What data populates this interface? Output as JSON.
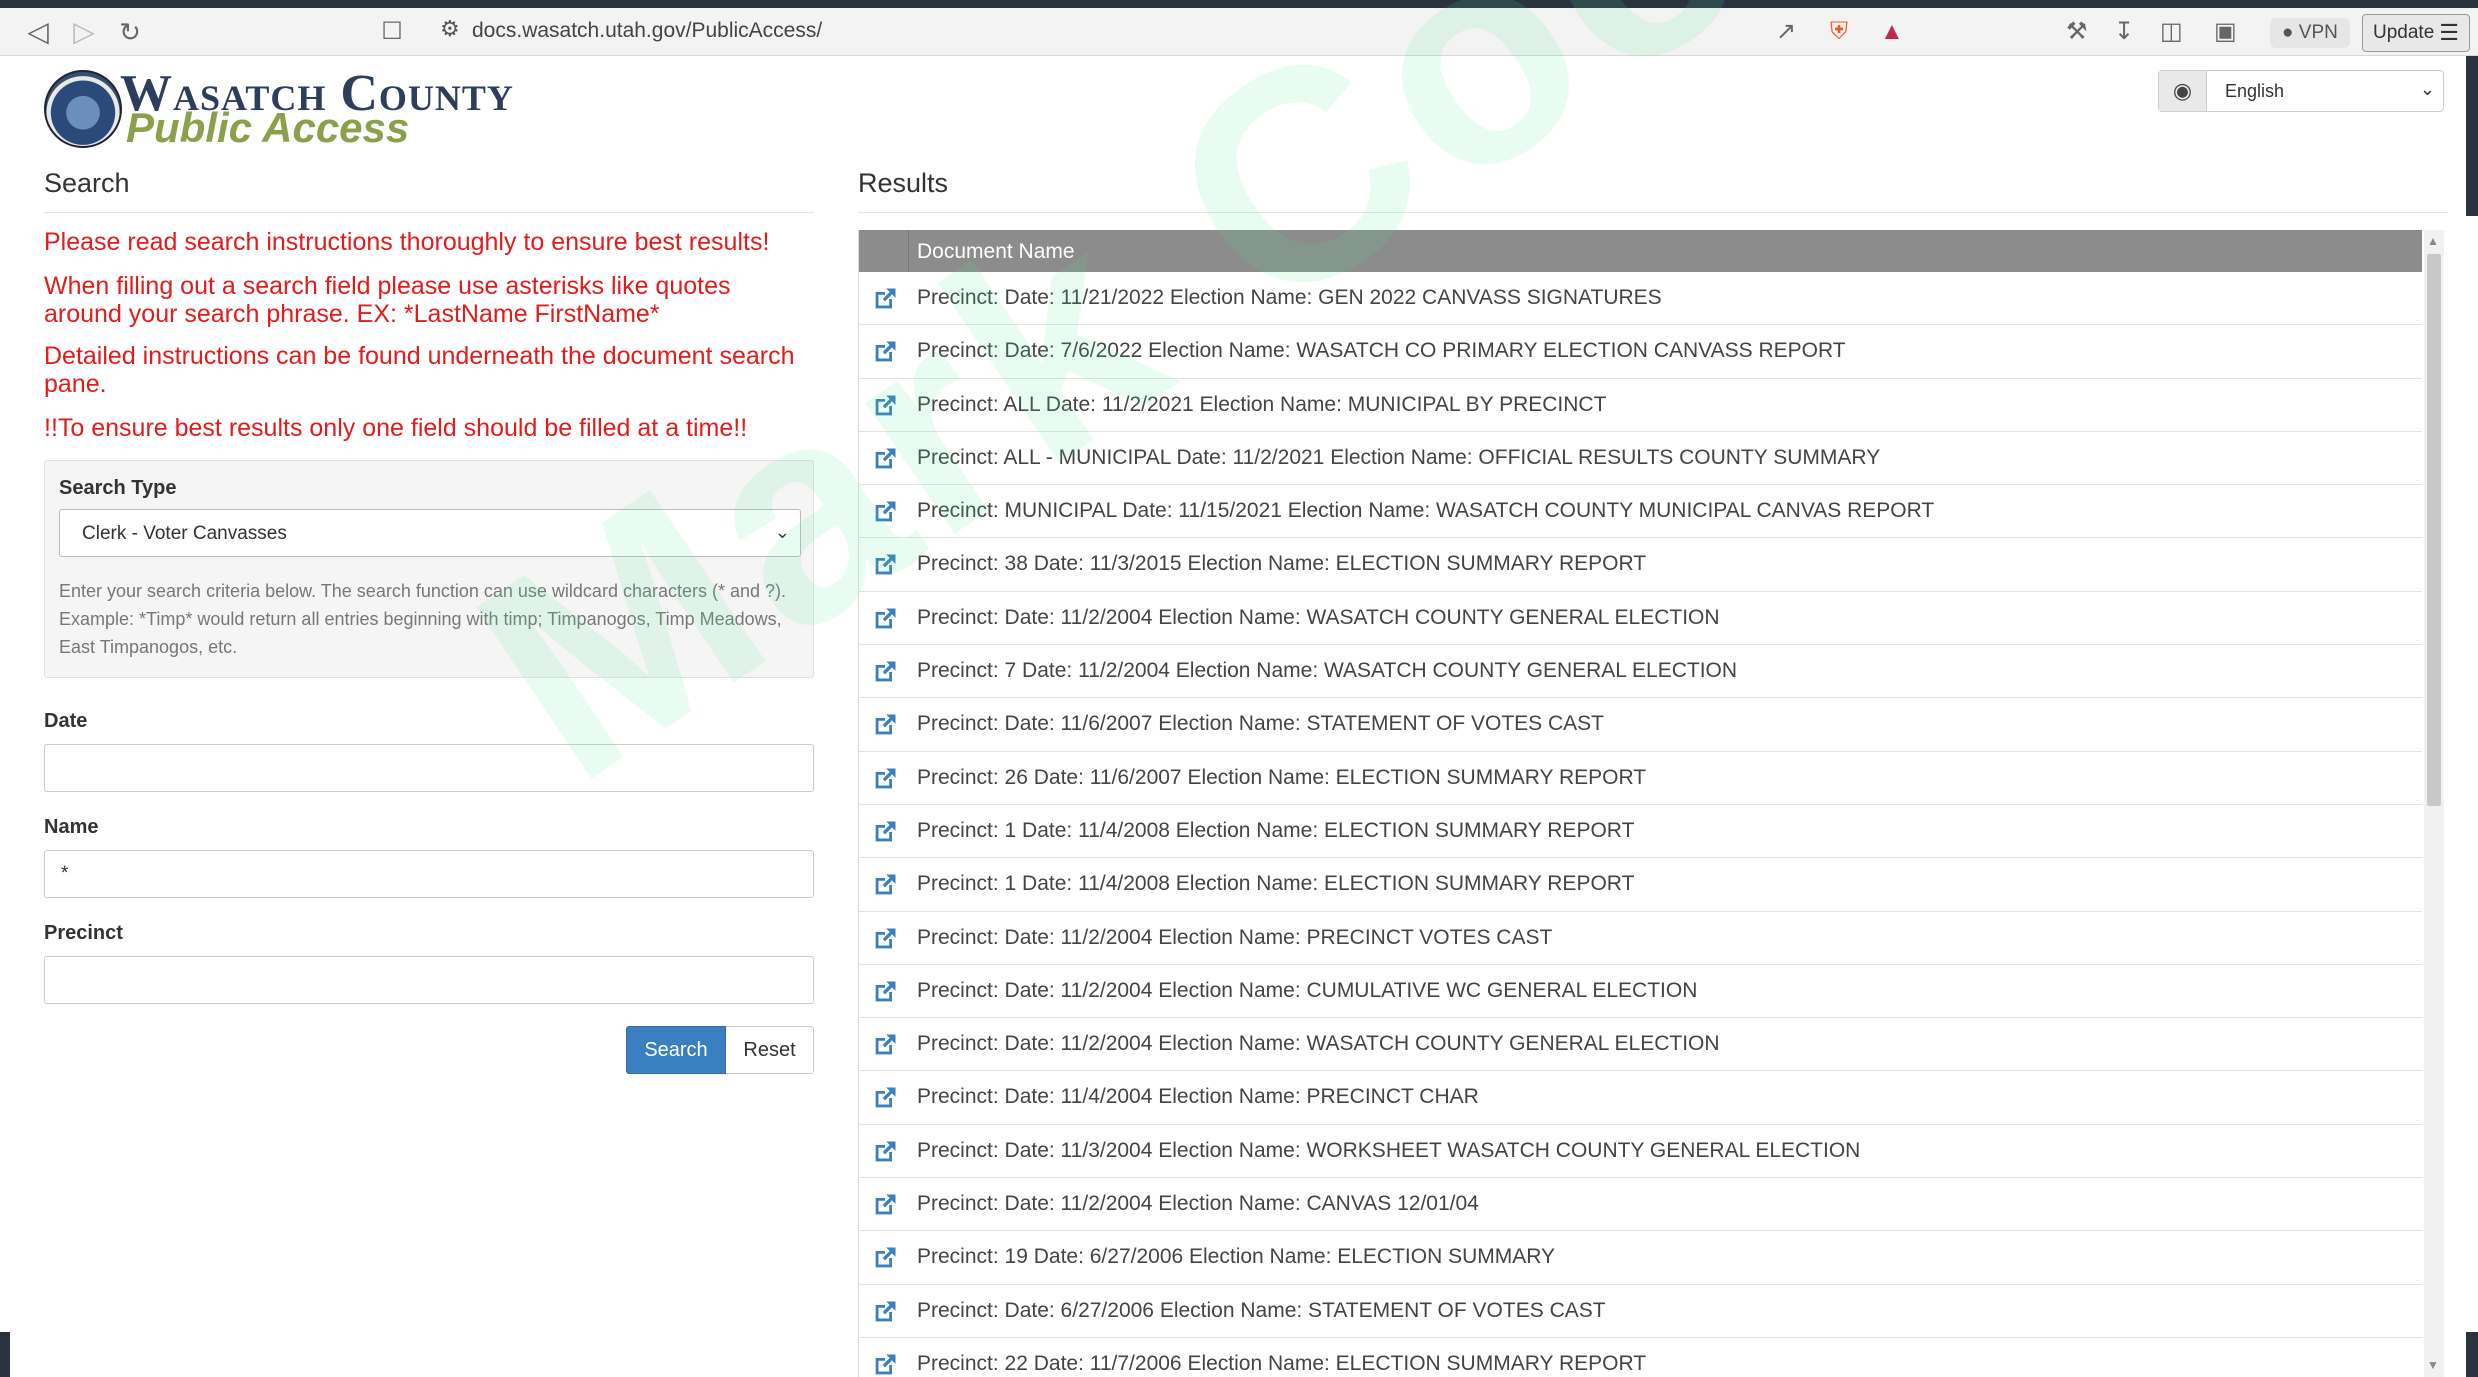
{
  "browser": {
    "url": "docs.wasatch.utah.gov/PublicAccess/",
    "vpn_label": "VPN",
    "update_label": "Update"
  },
  "header": {
    "logo_line1": "Wasatch County",
    "logo_line2": "Public Access",
    "language": "English"
  },
  "search": {
    "heading": "Search",
    "warnings": [
      "Please read search instructions thoroughly to ensure best results!",
      "When filling out a search field please use asterisks like quotes around your search phrase. EX: *LastName FirstName*",
      "Detailed instructions can be found underneath the document search pane.",
      "!!To ensure best results only one field should be filled at a time!!"
    ],
    "search_type_label": "Search Type",
    "search_type_value": "Clerk - Voter Canvasses",
    "help_text": "Enter your search criteria below. The search function can use wildcard characters (* and ?). Example: *Timp* would return all entries beginning with timp; Timpanogos, Timp Meadows, East Timpanogos, etc.",
    "date_label": "Date",
    "date_value": "",
    "name_label": "Name",
    "name_value": "*",
    "precinct_label": "Precinct",
    "precinct_value": "",
    "search_button": "Search",
    "reset_button": "Reset"
  },
  "results": {
    "heading": "Results",
    "column_header": "Document Name",
    "rows": [
      "Precinct: Date: 11/21/2022 Election Name: GEN 2022 CANVASS SIGNATURES",
      "Precinct: Date: 7/6/2022 Election Name: WASATCH CO PRIMARY ELECTION CANVASS REPORT",
      "Precinct: ALL Date: 11/2/2021 Election Name: MUNICIPAL BY PRECINCT",
      "Precinct: ALL - MUNICIPAL Date: 11/2/2021 Election Name: OFFICIAL RESULTS COUNTY SUMMARY",
      "Precinct: MUNICIPAL Date: 11/15/2021 Election Name: WASATCH COUNTY MUNICIPAL CANVAS REPORT",
      "Precinct: 38 Date: 11/3/2015 Election Name: ELECTION SUMMARY REPORT",
      "Precinct: Date: 11/2/2004 Election Name: WASATCH COUNTY GENERAL ELECTION",
      "Precinct: 7 Date: 11/2/2004 Election Name: WASATCH COUNTY GENERAL ELECTION",
      "Precinct: Date: 11/6/2007 Election Name: STATEMENT OF VOTES CAST",
      "Precinct: 26 Date: 11/6/2007 Election Name: ELECTION SUMMARY REPORT",
      "Precinct: 1 Date: 11/4/2008 Election Name: ELECTION SUMMARY REPORT",
      "Precinct: 1 Date: 11/4/2008 Election Name: ELECTION SUMMARY REPORT",
      "Precinct: Date: 11/2/2004 Election Name: PRECINCT VOTES CAST",
      "Precinct: Date: 11/2/2004 Election Name: CUMULATIVE WC GENERAL ELECTION",
      "Precinct: Date: 11/2/2004 Election Name: WASATCH COUNTY GENERAL ELECTION",
      "Precinct: Date: 11/4/2004 Election Name: PRECINCT CHAR",
      "Precinct: Date: 11/3/2004 Election Name: WORKSHEET WASATCH COUNTY GENERAL ELECTION",
      "Precinct: Date: 11/2/2004 Election Name: CANVAS 12/01/04",
      "Precinct: 19 Date: 6/27/2006 Election Name: ELECTION SUMMARY",
      "Precinct: Date: 6/27/2006 Election Name: STATEMENT OF VOTES CAST",
      "Precinct: 22 Date: 11/7/2006 Election Name: ELECTION SUMMARY REPORT"
    ]
  },
  "watermark": "Mark Cook",
  "colors": {
    "warning_red": "#e21b1b",
    "link_blue": "#3a7fc0",
    "header_gray": "#8c8c8c",
    "logo_navy": "#2d3e5c",
    "logo_green": "#8ba04a"
  }
}
